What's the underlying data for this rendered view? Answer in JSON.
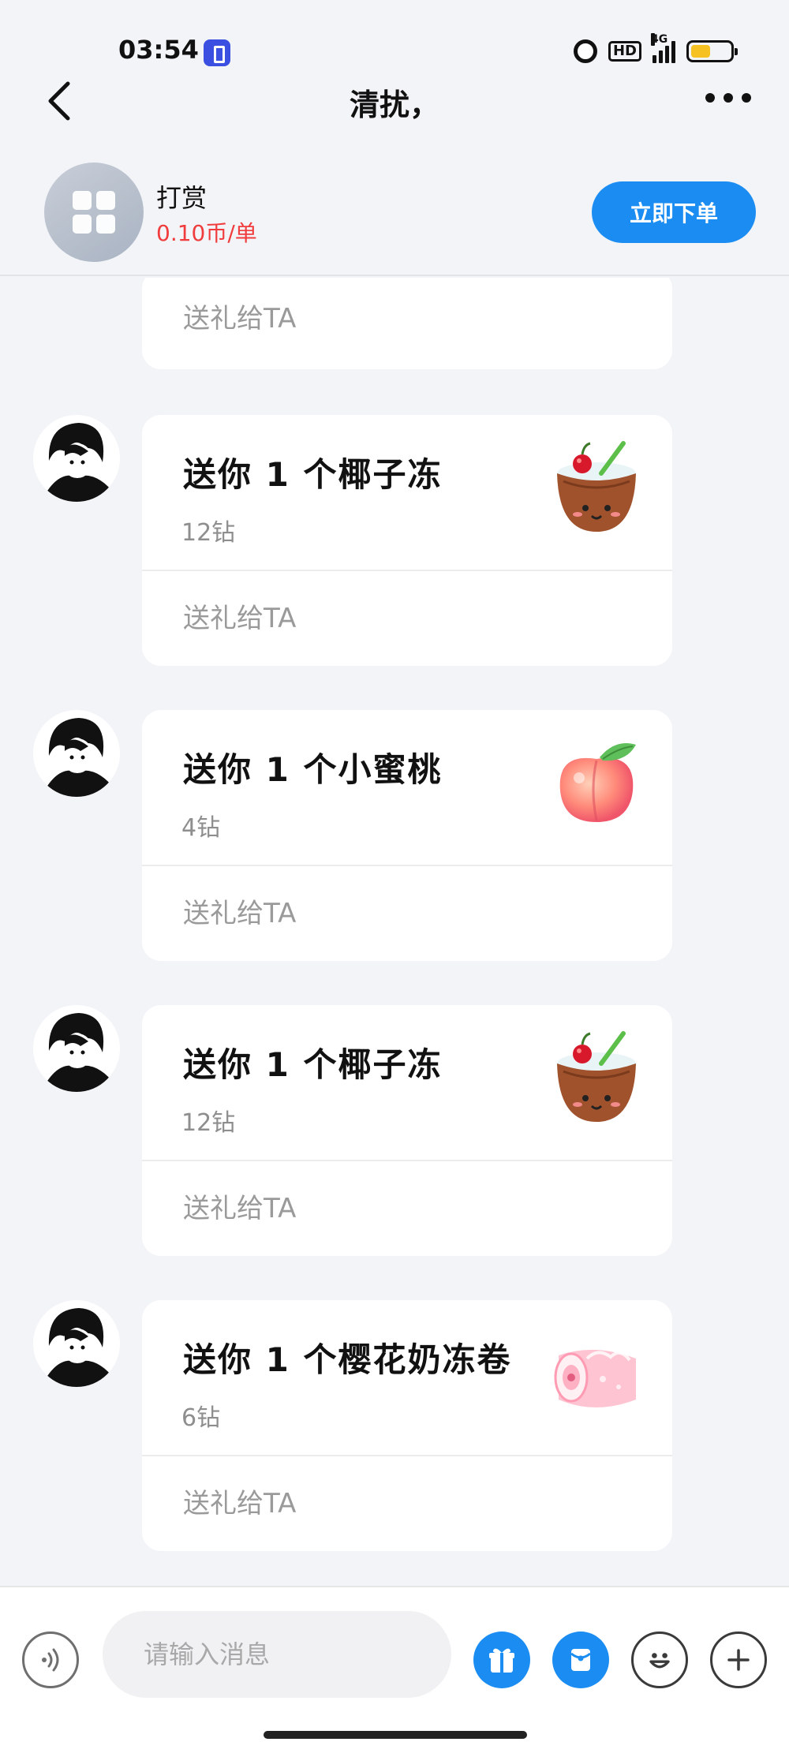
{
  "status_bar": {
    "time": "03:54",
    "network": "4G",
    "hd": "HD",
    "icons": [
      "app-notification-icon",
      "alarm-icon",
      "hd-icon",
      "signal-icon",
      "battery-icon"
    ]
  },
  "nav": {
    "title": "清扰，",
    "back_icon": "chevron-left-icon",
    "more_icon": "more-dots-icon"
  },
  "service": {
    "name": "打赏",
    "price": "0.10币/单",
    "order_button_label": "立即下单",
    "colors": {
      "accent": "#1b8df2",
      "price": "#f03c3c"
    }
  },
  "messages": {
    "partial_card": {
      "action_label": "送礼给TA"
    },
    "items": [
      {
        "title": "送你 1 个椰子冻",
        "price": "12钻",
        "action_label": "送礼给TA",
        "gift_icon": "coconut-jelly-icon"
      },
      {
        "title": "送你 1 个小蜜桃",
        "price": "4钻",
        "action_label": "送礼给TA",
        "gift_icon": "peach-icon"
      },
      {
        "title": "送你 1 个椰子冻",
        "price": "12钻",
        "action_label": "送礼给TA",
        "gift_icon": "coconut-jelly-icon"
      },
      {
        "title": "送你 1 个樱花奶冻卷",
        "price": "6钻",
        "action_label": "送礼给TA",
        "gift_icon": "sakura-roll-icon"
      }
    ]
  },
  "input_bar": {
    "placeholder": "请输入消息",
    "tools": [
      "voice-icon",
      "gift-icon",
      "red-packet-icon",
      "emoji-icon",
      "plus-icon"
    ]
  }
}
